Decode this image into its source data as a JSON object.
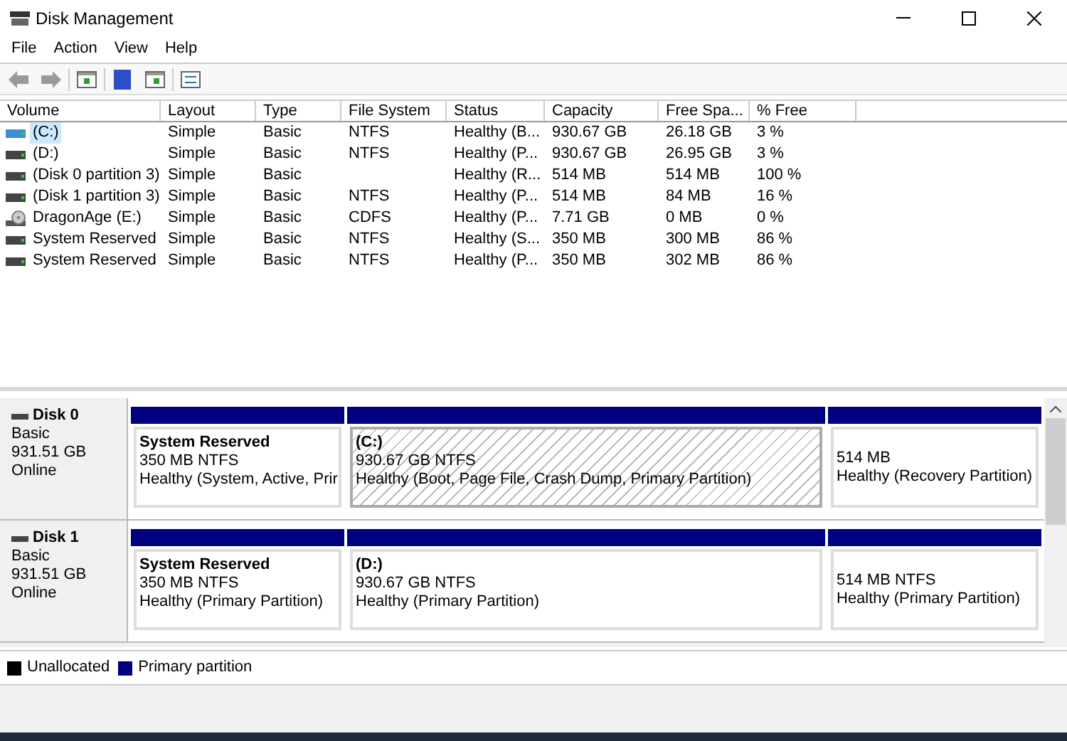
{
  "window": {
    "title": "Disk Management"
  },
  "menu": [
    "File",
    "Action",
    "View",
    "Help"
  ],
  "table": {
    "columns": [
      "Volume",
      "Layout",
      "Type",
      "File System",
      "Status",
      "Capacity",
      "Free Spa...",
      "% Free"
    ],
    "rows": [
      {
        "kind": "disk",
        "selected": true,
        "cells": [
          "(C:)",
          "Simple",
          "Basic",
          "NTFS",
          "Healthy (B...",
          "930.67 GB",
          "26.18 GB",
          "3 %"
        ]
      },
      {
        "kind": "disk",
        "selected": false,
        "cells": [
          "(D:)",
          "Simple",
          "Basic",
          "NTFS",
          "Healthy (P...",
          "930.67 GB",
          "26.95 GB",
          "3 %"
        ]
      },
      {
        "kind": "disk",
        "selected": false,
        "cells": [
          "(Disk 0 partition 3)",
          "Simple",
          "Basic",
          "",
          "Healthy (R...",
          "514 MB",
          "514 MB",
          "100 %"
        ]
      },
      {
        "kind": "disk",
        "selected": false,
        "cells": [
          "(Disk 1 partition 3)",
          "Simple",
          "Basic",
          "NTFS",
          "Healthy (P...",
          "514 MB",
          "84 MB",
          "16 %"
        ]
      },
      {
        "kind": "cd",
        "selected": false,
        "cells": [
          "DragonAge (E:)",
          "Simple",
          "Basic",
          "CDFS",
          "Healthy (P...",
          "7.71 GB",
          "0 MB",
          "0 %"
        ]
      },
      {
        "kind": "disk",
        "selected": false,
        "cells": [
          "System Reserved",
          "Simple",
          "Basic",
          "NTFS",
          "Healthy (S...",
          "350 MB",
          "300 MB",
          "86 %"
        ]
      },
      {
        "kind": "disk",
        "selected": false,
        "cells": [
          "System Reserved",
          "Simple",
          "Basic",
          "NTFS",
          "Healthy (P...",
          "350 MB",
          "302 MB",
          "86 %"
        ]
      }
    ]
  },
  "disks": [
    {
      "name": "Disk 0",
      "type": "Basic",
      "size": "931.51 GB",
      "state": "Online",
      "partitions": [
        {
          "name": "System Reserved",
          "size": "350 MB NTFS",
          "status": "Healthy (System, Active, Prir",
          "selected": false
        },
        {
          "name": "(C:)",
          "size": "930.67 GB NTFS",
          "status": "Healthy (Boot, Page File, Crash Dump, Primary Partition)",
          "selected": true
        },
        {
          "size": "514 MB",
          "status": "Healthy (Recovery Partition)",
          "selected": false
        }
      ]
    },
    {
      "name": "Disk 1",
      "type": "Basic",
      "size": "931.51 GB",
      "state": "Online",
      "partitions": [
        {
          "name": "System Reserved",
          "size": "350 MB NTFS",
          "status": "Healthy (Primary Partition)",
          "selected": false
        },
        {
          "name": "(D:)",
          "size": "930.67 GB NTFS",
          "status": "Healthy (Primary Partition)",
          "selected": false
        },
        {
          "size": "514 MB NTFS",
          "status": "Healthy (Primary Partition)",
          "selected": false
        }
      ]
    }
  ],
  "legend": [
    {
      "label": "Unallocated",
      "color": "#000000"
    },
    {
      "label": "Primary partition",
      "color": "#000080"
    }
  ]
}
